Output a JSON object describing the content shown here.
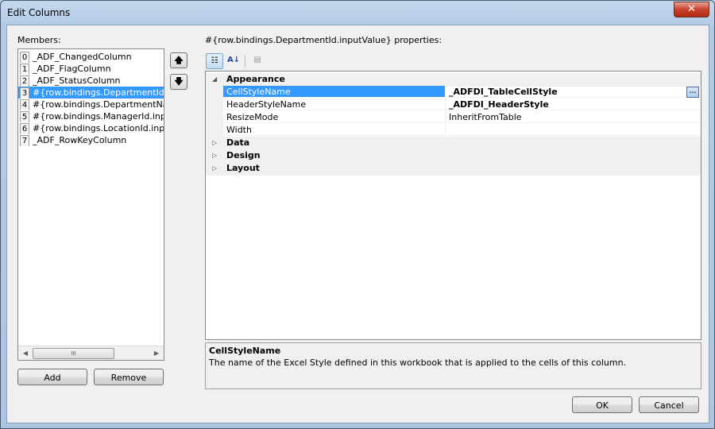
{
  "window": {
    "title": "Edit Columns",
    "close_label": "✕"
  },
  "members": {
    "label": "Members:",
    "items": [
      {
        "index": "0",
        "label": "_ADF_ChangedColumn"
      },
      {
        "index": "1",
        "label": "_ADF_FlagColumn"
      },
      {
        "index": "2",
        "label": "_ADF_StatusColumn"
      },
      {
        "index": "3",
        "label": "#{row.bindings.DepartmentId.inputValue}"
      },
      {
        "index": "4",
        "label": "#{row.bindings.DepartmentName.inputValue}"
      },
      {
        "index": "5",
        "label": "#{row.bindings.ManagerId.inputValue}"
      },
      {
        "index": "6",
        "label": "#{row.bindings.LocationId.inputValue}"
      },
      {
        "index": "7",
        "label": "_ADF_RowKeyColumn"
      }
    ],
    "selected_index": 3,
    "scroll_thumb_label": "III",
    "add_label": "Add",
    "remove_label": "Remove",
    "move_up_label": "🡅",
    "move_down_label": "🡇"
  },
  "properties": {
    "header": "#{row.bindings.DepartmentId.inputValue} properties:",
    "toolbar": {
      "categorized_icon": "categorized-icon",
      "alphabetical_icon": "alphabetical-icon",
      "property_pages_icon": "property-pages-icon"
    },
    "categories": {
      "appearance": {
        "label": "Appearance",
        "expanded": true,
        "rows": [
          {
            "name": "CellStyleName",
            "value": "_ADFDI_TableCellStyle",
            "bold": true,
            "selected": true
          },
          {
            "name": "HeaderStyleName",
            "value": "_ADFDI_HeaderStyle",
            "bold": true
          },
          {
            "name": "ResizeMode",
            "value": "InheritFromTable",
            "bold": false
          },
          {
            "name": "Width",
            "value": "",
            "bold": false
          }
        ]
      },
      "data": {
        "label": "Data",
        "expanded": false
      },
      "design": {
        "label": "Design",
        "expanded": false
      },
      "layout": {
        "label": "Layout",
        "expanded": false
      }
    },
    "ellipsis_label": "...",
    "description": {
      "title": "CellStyleName",
      "text": "The name of the Excel Style defined in this workbook that is applied to the cells of this column."
    }
  },
  "footer": {
    "ok_label": "OK",
    "cancel_label": "Cancel"
  }
}
